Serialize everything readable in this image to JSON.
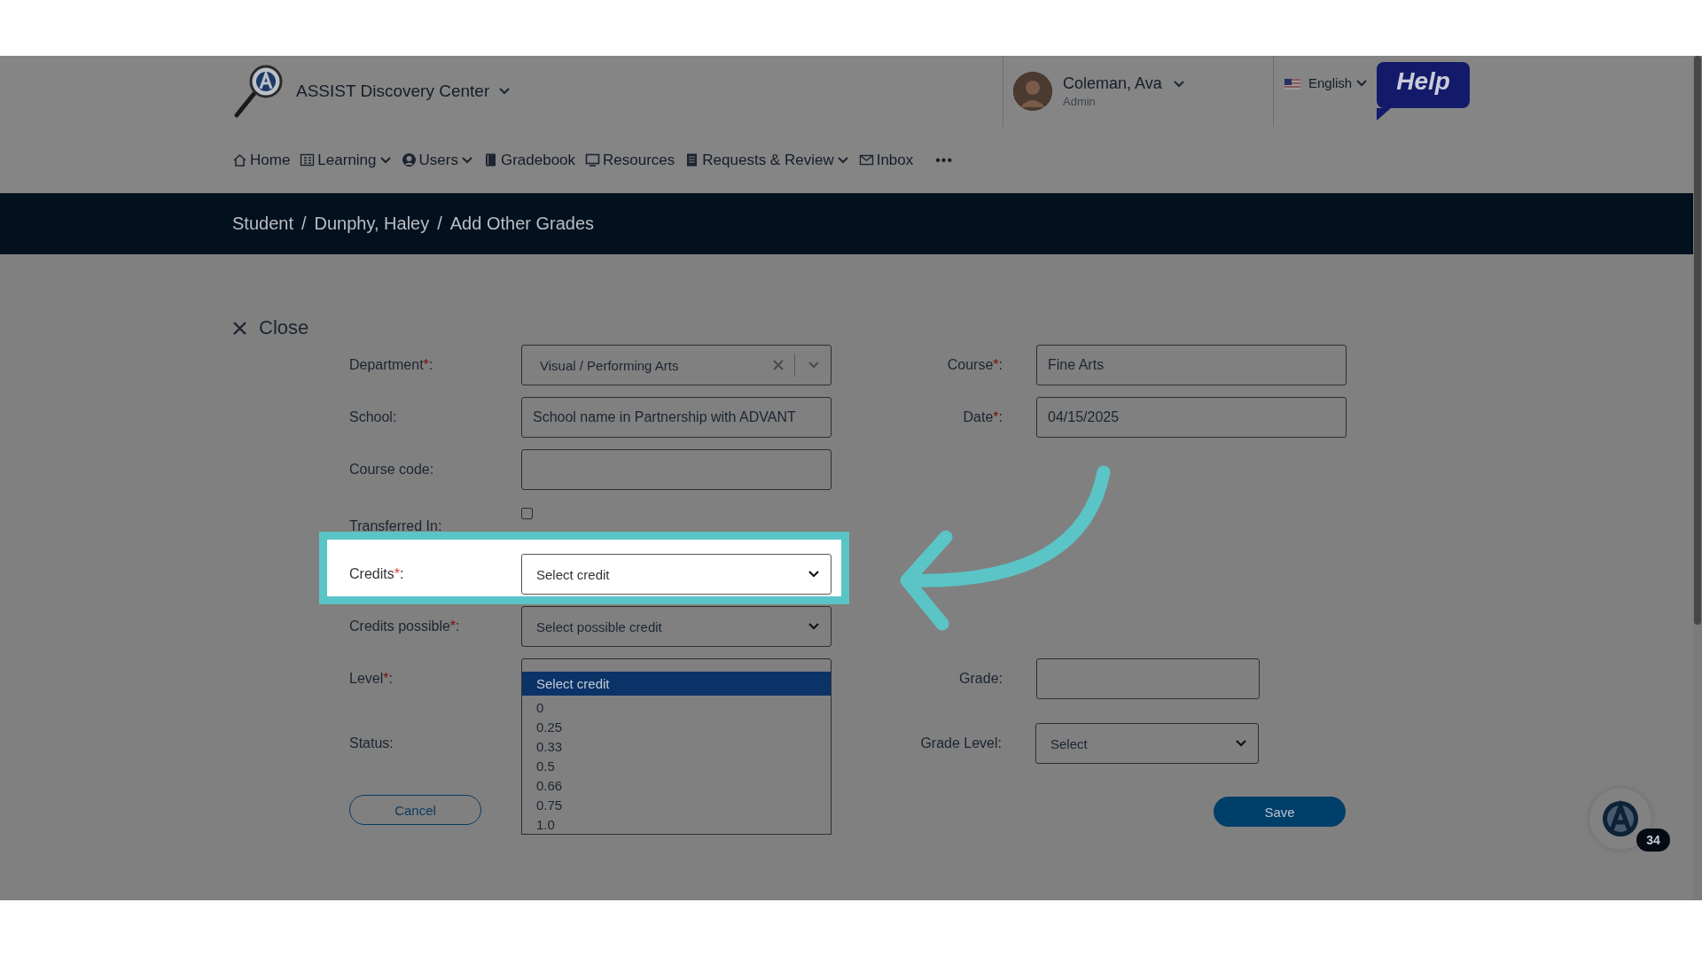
{
  "app": {
    "title": "ASSIST Discovery Center"
  },
  "user": {
    "name": "Coleman, Ava",
    "role": "Admin"
  },
  "language": "English",
  "help": "Help",
  "nav": [
    {
      "label": "Home",
      "caret": false
    },
    {
      "label": "Learning",
      "caret": true
    },
    {
      "label": "Users",
      "caret": true
    },
    {
      "label": "Gradebook",
      "caret": false
    },
    {
      "label": "Resources",
      "caret": false
    },
    {
      "label": "Requests & Review",
      "caret": true
    },
    {
      "label": "Inbox",
      "caret": false
    }
  ],
  "nav_more": "•••",
  "breadcrumb": {
    "separator": "/",
    "items": [
      "Student",
      "Dunphy, Haley",
      "Add Other Grades"
    ]
  },
  "close": "Close",
  "form": {
    "required_mark": "*",
    "label_suffix": ":",
    "rows": [
      {
        "highlighted": false,
        "left": {
          "label": "Department",
          "required": true,
          "control": {
            "kind": "combo",
            "value": "Visual / Performing Arts"
          }
        },
        "right": {
          "label": "Course",
          "required": true,
          "control": {
            "kind": "text",
            "value": "Fine Arts"
          }
        }
      },
      {
        "highlighted": false,
        "left": {
          "label": "School",
          "required": false,
          "control": {
            "kind": "text",
            "value": "School name in Partnership with ADVANT"
          }
        },
        "right": {
          "label": "Date",
          "required": true,
          "control": {
            "kind": "text",
            "value": "04/15/2025"
          }
        }
      },
      {
        "highlighted": false,
        "left": {
          "label": "Course code",
          "required": false,
          "control": {
            "kind": "text"
          }
        }
      },
      {
        "highlighted": false,
        "left": {
          "label": "Transferred In",
          "required": false,
          "control": {
            "kind": "checkbox",
            "checked": false
          }
        }
      },
      {
        "highlighted": true,
        "left": {
          "label": "Credits",
          "required": true,
          "control": {
            "kind": "select",
            "value": "Select credit"
          }
        }
      },
      {
        "highlighted": false,
        "left": {
          "label": "Credits possible",
          "required": true,
          "control": {
            "kind": "select",
            "value": "Select possible credit"
          }
        }
      },
      {
        "highlighted": false,
        "left": {
          "label": "Level",
          "required": true,
          "control": {
            "kind": "listbox",
            "options": [
              {
                "label": "Select credit",
                "selected": true
              },
              {
                "label": "0",
                "selected": false
              },
              {
                "label": "0.25",
                "selected": false
              },
              {
                "label": "0.33",
                "selected": false
              },
              {
                "label": "0.5",
                "selected": false
              },
              {
                "label": "0.66",
                "selected": false
              },
              {
                "label": "0.75",
                "selected": false
              },
              {
                "label": "1.0",
                "selected": false
              }
            ]
          }
        },
        "right": {
          "label": "Grade",
          "required": false,
          "control": {
            "kind": "text"
          }
        }
      },
      {
        "highlighted": false,
        "left": {
          "label": "Status",
          "required": false
        },
        "right": {
          "label": "Grade Level",
          "required": false,
          "control": {
            "kind": "select",
            "value": "Select"
          }
        }
      }
    ]
  },
  "buttons": {
    "cancel": "Cancel",
    "save": "Save"
  },
  "chat": {
    "badge": "34"
  }
}
